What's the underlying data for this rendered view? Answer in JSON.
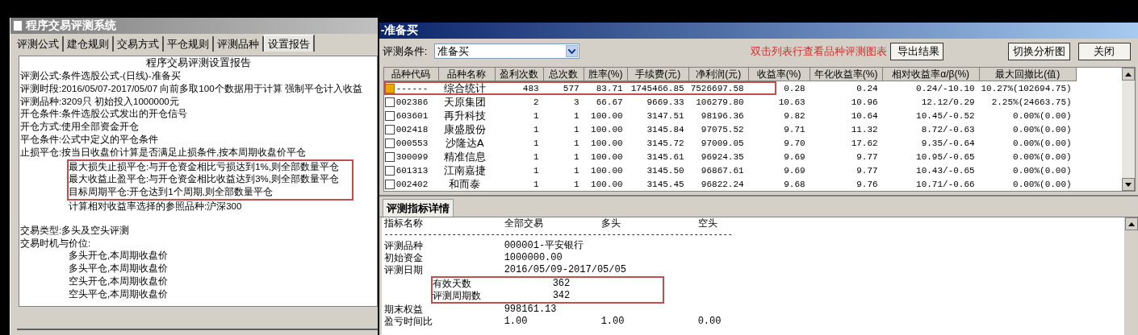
{
  "left_window": {
    "title": "程序交易评测系统",
    "tabs": [
      {
        "label": "评测公式",
        "selected": false
      },
      {
        "label": "建仓规则",
        "selected": false
      },
      {
        "label": "交易方式",
        "selected": false
      },
      {
        "label": "平仓规则",
        "selected": false
      },
      {
        "label": "评测品种",
        "selected": false
      },
      {
        "label": "设置报告",
        "selected": true
      }
    ],
    "report": {
      "heading": "程序交易评测设置报告",
      "sections": [
        [
          {
            "kind": "field",
            "label": "评测公式:",
            "value": "条件选股公式-(日线)-准备买",
            "highlighted": false
          },
          {
            "kind": "field",
            "label": "评测时段:",
            "value": "2016/05/07-2017/05/07 向前多取100个数据用于计算 强制平仓计入收益",
            "highlighted": false
          },
          {
            "kind": "field",
            "label": "评测品种:",
            "value": "3209只 初始投入1000000元",
            "highlighted": false
          },
          {
            "kind": "field",
            "label": "开仓条件:",
            "value": "条件选股公式发出的开仓信号",
            "highlighted": false
          },
          {
            "kind": "field",
            "label": "开仓方式:",
            "value": "使用全部资金开仓",
            "highlighted": false
          },
          {
            "kind": "field",
            "label": "平仓条件:",
            "value": "公式中定义的平仓条件",
            "highlighted": false
          },
          {
            "kind": "field",
            "label": "止损平仓:",
            "value": "按当日收盘价计算是否满足止损条件,按本周期收盘价平仓",
            "highlighted": false
          },
          {
            "kind": "sub",
            "value": "最大损失止损平仓:与开仓资金相比亏损达到1%,则全部数量平仓",
            "highlighted": true
          },
          {
            "kind": "sub",
            "value": "最大收益止盈平仓:与开仓资金相比收益达到3%,则全部数量平仓",
            "highlighted": true
          },
          {
            "kind": "sub",
            "value": "目标周期平仓:开仓达到1个周期,则全部数量平仓",
            "highlighted": true
          },
          {
            "kind": "sub",
            "value": "计算相对收益率选择的参照品种:沪深300",
            "highlighted": false
          }
        ],
        [
          {
            "kind": "field",
            "label": "交易类型:",
            "value": "多头及空头评测",
            "highlighted": false
          },
          {
            "kind": "field",
            "label": "交易时机与价位:",
            "highlighted": false
          },
          {
            "kind": "sub",
            "value": "多头开仓,本周期收盘价",
            "highlighted": false
          },
          {
            "kind": "sub",
            "value": "多头平仓,本周期收盘价",
            "highlighted": false
          },
          {
            "kind": "sub",
            "value": "空头开仓,本周期收盘价",
            "highlighted": false
          },
          {
            "kind": "sub",
            "value": "空头平仓,本周期收盘价",
            "highlighted": false
          }
        ]
      ]
    }
  },
  "right_window": {
    "title": "-准备买",
    "condition": {
      "label": "评测条件:",
      "value": "准备买"
    },
    "hint": "双击列表行查看品种评测图表",
    "buttons": [
      "导出结果",
      "切换分析图",
      "关闭"
    ],
    "table": {
      "columns": [
        "品种代码",
        "品种名称",
        "盈利次数",
        "总次数",
        "胜率(%)",
        "手续费(元)",
        "净利润(元)",
        "收益率(%)",
        "年化收益率(%)",
        "相对收益率α/β(%)",
        "最大回撤比(值)"
      ],
      "rows": [
        {
          "kind": "summary",
          "highlighted": true,
          "cells": [
            "------",
            "综合统计",
            "483",
            "577",
            "83.71",
            "1745466.85",
            "7526697.58",
            "0.28",
            "0.24",
            "0.24/-10.10",
            "10.27%(102694.75)"
          ]
        },
        {
          "kind": "stock",
          "highlighted": false,
          "cells": [
            "002386",
            "天原集团",
            "2",
            "3",
            "66.67",
            "9669.33",
            "106279.80",
            "10.63",
            "10.96",
            "12.12/0.29",
            "2.25%(24663.75)"
          ]
        },
        {
          "kind": "stock",
          "highlighted": false,
          "cells": [
            "603601",
            "再升科技",
            "1",
            "1",
            "100.00",
            "3147.51",
            "98196.36",
            "9.82",
            "10.64",
            "10.45/-0.52",
            "0.00%(0.00)"
          ]
        },
        {
          "kind": "stock",
          "highlighted": false,
          "cells": [
            "002418",
            "康盛股份",
            "1",
            "1",
            "100.00",
            "3145.84",
            "97075.52",
            "9.71",
            "11.32",
            "8.72/-0.63",
            "0.00%(0.00)"
          ]
        },
        {
          "kind": "stock",
          "highlighted": false,
          "cells": [
            "000553",
            "沙隆达A",
            "1",
            "1",
            "100.00",
            "3145.72",
            "97009.05",
            "9.70",
            "17.62",
            "9.35/-0.64",
            "0.00%(0.00)"
          ]
        },
        {
          "kind": "stock",
          "highlighted": false,
          "cells": [
            "300099",
            "精准信息",
            "1",
            "1",
            "100.00",
            "3145.61",
            "96924.35",
            "9.69",
            "9.77",
            "10.95/-0.65",
            "0.00%(0.00)"
          ]
        },
        {
          "kind": "stock",
          "highlighted": false,
          "cells": [
            "601313",
            "江南嘉捷",
            "1",
            "1",
            "100.00",
            "3145.50",
            "96867.61",
            "9.69",
            "9.77",
            "10.43/-0.65",
            "0.00%(0.00)"
          ]
        },
        {
          "kind": "stock",
          "highlighted": false,
          "cells": [
            "002402",
            "和而泰",
            "1",
            "1",
            "100.00",
            "3145.45",
            "96822.24",
            "9.68",
            "9.76",
            "10.71/-0.66",
            "0.00%(0.00)"
          ]
        }
      ]
    },
    "detail": {
      "tab": "评测指标详情",
      "columns": [
        "指标名称",
        "全部交易",
        "多头",
        "空头"
      ],
      "divider": "------------------------------------------------------------------------",
      "rows": [
        {
          "cells": [
            "评测品种",
            "000001-平安银行"
          ],
          "highlighted": false
        },
        {
          "cells": [
            "初始资金",
            "1000000.00"
          ],
          "highlighted": false
        },
        {
          "cells": [
            "评测日期",
            "2016/05/09-2017/05/05"
          ],
          "highlighted": false
        },
        {
          "cells": [
            "有效天数",
            "362"
          ],
          "highlighted": true
        },
        {
          "cells": [
            "评测周期数",
            "342"
          ],
          "highlighted": true
        },
        {
          "cells": [
            "期末权益",
            "998161.13"
          ],
          "highlighted": false
        },
        {
          "cells": [
            "盈亏时间比",
            "1.00",
            "1.00",
            "0.00"
          ],
          "highlighted": false
        }
      ]
    }
  }
}
